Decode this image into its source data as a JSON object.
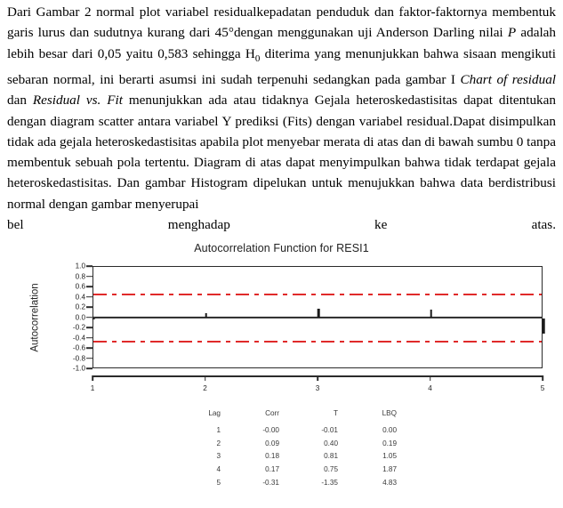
{
  "narrative": {
    "segments": [
      {
        "t": "Dari Gambar  2 normal plot variabel residualkepadatan penduduk dan faktor-faktornya membentuk garis lurus dan sudutnya kurang dari 45°dengan menggunakan uji Anderson Darling nilai ",
        "style": "normal"
      },
      {
        "t": "P",
        "style": "italic"
      },
      {
        "t": " adalah lebih besar dari 0,05 yaitu 0,583 sehingga H",
        "style": "normal"
      },
      {
        "t": "0",
        "style": "sub"
      },
      {
        "t": " diterima yang menunjukkan bahwa sisaan mengikuti sebaran normal, ini berarti asumsi ini sudah terpenuhi  sedangkan pada gambar I ",
        "style": "normal"
      },
      {
        "t": "Chart of residual",
        "style": "italic"
      },
      {
        "t": " dan ",
        "style": "normal"
      },
      {
        "t": "Residual vs. Fit",
        "style": "italic"
      },
      {
        "t": " menunjukkan ada atau tidaknya Gejala heteroskedastisitas dapat ditentukan dengan diagram scatter antara variabel Y prediksi (Fits) dengan variabel residual.Dapat disimpulkan tidak ada gejala heteroskedastisitas apabila plot menyebar merata di atas dan di bawah sumbu 0 tanpa membentuk sebuah pola tertentu. Diagram di atas dapat menyimpulkan bahwa tidak terdapat gejala heteroskedastisitas.  Dan gambar Histogram dipelukan untuk menujukkan bahwa data berdistribusi normal dengan gambar menyerupai",
        "style": "normal"
      }
    ],
    "last_line": [
      "bel",
      "menghadap",
      "ke",
      "atas."
    ]
  },
  "chart_data": {
    "type": "bar",
    "title": "Autocorrelation Function for RESI1",
    "xlabel": "",
    "ylabel": "Autocorrelation",
    "categories": [
      "1",
      "2",
      "3",
      "4",
      "5"
    ],
    "values": [
      -0.0,
      0.09,
      0.18,
      0.17,
      -0.31
    ],
    "ylim": [
      -1.0,
      1.0
    ],
    "y_ticks": [
      "1.0",
      "0.8",
      "0.6",
      "0.4",
      "0.2",
      "0.0",
      "-0.2",
      "-0.4",
      "-0.6",
      "-0.8",
      "-1.0"
    ],
    "y_tick_values": [
      1.0,
      0.8,
      0.6,
      0.4,
      0.2,
      0.0,
      -0.2,
      -0.4,
      -0.6,
      -0.8,
      -1.0
    ],
    "x_ticks": [
      "1",
      "2",
      "3",
      "4",
      "5"
    ],
    "confidence_bounds": [
      0.46,
      -0.46
    ],
    "bound_color": "#e02a2a",
    "bar_color": "#1a1a1a",
    "grid": false,
    "legend": "none"
  },
  "table": {
    "headers": [
      "Lag",
      "Corr",
      "T",
      "LBQ"
    ],
    "rows": [
      {
        "lag": "1",
        "corr": "-0.00",
        "t": "-0.01",
        "lbq": "0.00"
      },
      {
        "lag": "2",
        "corr": "0.09",
        "t": "0.40",
        "lbq": "0.19"
      },
      {
        "lag": "3",
        "corr": "0.18",
        "t": "0.81",
        "lbq": "1.05"
      },
      {
        "lag": "4",
        "corr": "0.17",
        "t": "0.75",
        "lbq": "1.87"
      },
      {
        "lag": "5",
        "corr": "-0.31",
        "t": "-1.35",
        "lbq": "4.83"
      }
    ]
  }
}
